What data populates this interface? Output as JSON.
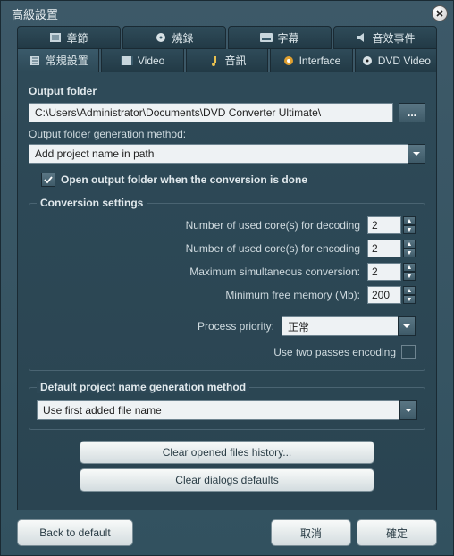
{
  "dialog": {
    "title": "高級設置"
  },
  "tabs_top": [
    {
      "label": "章節",
      "icon": "chapters-icon"
    },
    {
      "label": "燒錄",
      "icon": "burn-icon"
    },
    {
      "label": "字幕",
      "icon": "subtitle-icon"
    },
    {
      "label": "音效事件",
      "icon": "sound-events-icon"
    }
  ],
  "tabs_bottom": [
    {
      "label": "常規設置",
      "icon": "general-icon",
      "active": true
    },
    {
      "label": "Video",
      "icon": "video-icon"
    },
    {
      "label": "音訊",
      "icon": "audio-icon"
    },
    {
      "label": "Interface",
      "icon": "interface-icon"
    },
    {
      "label": "DVD Video",
      "icon": "dvd-icon"
    }
  ],
  "output": {
    "section_label": "Output folder",
    "path": "C:\\Users\\Administrator\\Documents\\DVD Converter Ultimate\\",
    "method_label": "Output folder generation method:",
    "method_value": "Add project name in path",
    "open_folder_label": "Open output folder when the conversion is done",
    "open_folder_checked": true
  },
  "conversion": {
    "legend": "Conversion settings",
    "decode_label": "Number of used core(s) for decoding",
    "decode_value": "2",
    "encode_label": "Number of used core(s) for encoding",
    "encode_value": "2",
    "maxsim_label": "Maximum simultaneous conversion:",
    "maxsim_value": "2",
    "minmem_label": "Minimum free memory (Mb):",
    "minmem_value": "200",
    "priority_label": "Process priority:",
    "priority_value": "正常",
    "two_pass_label": "Use two passes encoding",
    "two_pass_checked": false
  },
  "default_project": {
    "legend": "Default project name generation method",
    "value": "Use first added file name"
  },
  "buttons": {
    "clear_history": "Clear opened files history...",
    "clear_dialogs": "Clear dialogs defaults",
    "back_default": "Back to default",
    "cancel": "取消",
    "ok": "確定"
  }
}
